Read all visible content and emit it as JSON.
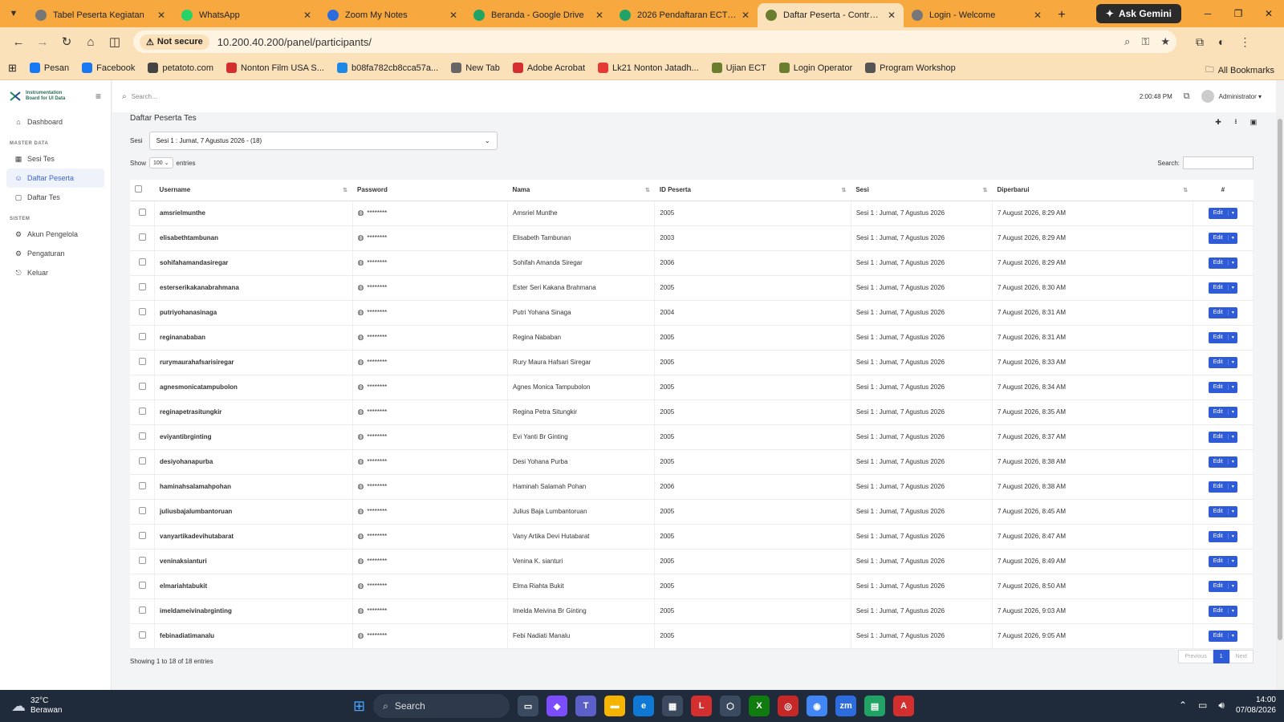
{
  "browser": {
    "tabs": [
      {
        "title": "Tabel Peserta Kegiatan",
        "color": "#777777"
      },
      {
        "title": "WhatsApp",
        "color": "#25d366"
      },
      {
        "title": "Zoom My Notes",
        "color": "#2d6cdf"
      },
      {
        "title": "Beranda - Google Drive",
        "color": "#1fa463"
      },
      {
        "title": "2026 Pendaftaran ECT Offli",
        "color": "#21a366"
      },
      {
        "title": "Daftar Peserta - Control Par",
        "color": "#6b7d2e"
      },
      {
        "title": "Login - Welcome",
        "color": "#777777"
      }
    ],
    "gemini_label": "Ask Gemini",
    "security_label": "Not secure",
    "url": "10.200.40.200/panel/participants/",
    "bookmarks": [
      {
        "label": "Pesan",
        "color": "#1877f2"
      },
      {
        "label": "Facebook",
        "color": "#1877f2"
      },
      {
        "label": "petatoto.com",
        "color": "#444444"
      },
      {
        "label": "Nonton Film USA S...",
        "color": "#d32f2f"
      },
      {
        "label": "b08fa782cb8cca57a...",
        "color": "#1e88e5"
      },
      {
        "label": "New Tab",
        "color": "#666666"
      },
      {
        "label": "Adobe Acrobat",
        "color": "#d32f2f"
      },
      {
        "label": "Lk21 Nonton Jatadh...",
        "color": "#e53935"
      },
      {
        "label": "Ujian ECT",
        "color": "#6b7d2e"
      },
      {
        "label": "Login Operator",
        "color": "#6b7d2e"
      },
      {
        "label": "Program Workshop",
        "color": "#555555"
      }
    ],
    "all_bookmarks_label": "All Bookmarks"
  },
  "sidebar": {
    "brand": "Instrumentation Board for UI Data",
    "items": [
      {
        "label": "Dashboard",
        "icon": "⌂"
      },
      {
        "category": "MASTER DATA"
      },
      {
        "label": "Sesi Tes",
        "icon": "▦"
      },
      {
        "label": "Daftar Peserta",
        "icon": "☺",
        "active": true
      },
      {
        "label": "Daftar Tes",
        "icon": "▢"
      },
      {
        "category": "SISTEM"
      },
      {
        "label": "Akun Pengelola",
        "icon": "⚙"
      },
      {
        "label": "Pengaturan",
        "icon": "⚙"
      },
      {
        "label": "Keluar",
        "icon": "⎋"
      }
    ]
  },
  "topbar": {
    "search_placeholder": "Search...",
    "time": "2:00:48 PM",
    "user": "Administrator ▾"
  },
  "main": {
    "title": "Daftar Peserta Tes",
    "sesi_label": "Sesi",
    "sesi_value": "Sesi 1 : Jumat, 7 Agustus 2026 - (18)",
    "show_label": "Show",
    "show_value": "100",
    "entries_label": "entries",
    "search_label": "Search:",
    "columns": [
      "Username",
      "Password",
      "Nama",
      "ID Peserta",
      "Sesi",
      "Diperbarui",
      "#"
    ],
    "password_mask": "********",
    "edit_label": "Edit",
    "rows": [
      [
        "amsrielmunthe",
        "Amsriel Munthe",
        "2005",
        "Sesi 1 : Jumat, 7 Agustus 2026",
        "7 August 2026, 8:29 AM"
      ],
      [
        "elisabethtambunan",
        "Elisabeth Tambunan",
        "2003",
        "Sesi 1 : Jumat, 7 Agustus 2026",
        "7 August 2026, 8:29 AM"
      ],
      [
        "sohifahamandasiregar",
        "Sohifah Amanda Siregar",
        "2006",
        "Sesi 1 : Jumat, 7 Agustus 2026",
        "7 August 2026, 8:29 AM"
      ],
      [
        "esterserikakanabrahmana",
        "Ester Seri Kakana Brahmana",
        "2005",
        "Sesi 1 : Jumat, 7 Agustus 2026",
        "7 August 2026, 8:30 AM"
      ],
      [
        "putriyohanasinaga",
        "Putri Yohana Sinaga",
        "2004",
        "Sesi 1 : Jumat, 7 Agustus 2026",
        "7 August 2026, 8:31 AM"
      ],
      [
        "reginanababan",
        "Regina Nababan",
        "2005",
        "Sesi 1 : Jumat, 7 Agustus 2026",
        "7 August 2026, 8:31 AM"
      ],
      [
        "rurymaurahafsarisiregar",
        "Rury Maura Hafsari Siregar",
        "2005",
        "Sesi 1 : Jumat, 7 Agustus 2026",
        "7 August 2026, 8:33 AM"
      ],
      [
        "agnesmonicatampubolon",
        "Agnes Monica Tampubolon",
        "2005",
        "Sesi 1 : Jumat, 7 Agustus 2026",
        "7 August 2026, 8:34 AM"
      ],
      [
        "reginapetrasitungkir",
        "Regina Petra Situngkir",
        "2005",
        "Sesi 1 : Jumat, 7 Agustus 2026",
        "7 August 2026, 8:35 AM"
      ],
      [
        "eviyantibrginting",
        "Evi Yanti Br Ginting",
        "2005",
        "Sesi 1 : Jumat, 7 Agustus 2026",
        "7 August 2026, 8:37 AM"
      ],
      [
        "desiyohanapurba",
        "Desi Yohana Purba",
        "2005",
        "Sesi 1 : Jumat, 7 Agustus 2026",
        "7 August 2026, 8:38 AM"
      ],
      [
        "haminahsalamahpohan",
        "Haminah Salamah Pohan",
        "2006",
        "Sesi 1 : Jumat, 7 Agustus 2026",
        "7 August 2026, 8:38 AM"
      ],
      [
        "juliusbajalumbantoruan",
        "Julius Baja Lumbantoruan",
        "2005",
        "Sesi 1 : Jumat, 7 Agustus 2026",
        "7 August 2026, 8:45 AM"
      ],
      [
        "vanyartikadevihutabarat",
        "Vany Artika Devi Hutabarat",
        "2005",
        "Sesi 1 : Jumat, 7 Agustus 2026",
        "7 August 2026, 8:47 AM"
      ],
      [
        "veninaksianturi",
        "Venina K. sianturi",
        "2005",
        "Sesi 1 : Jumat, 7 Agustus 2026",
        "7 August 2026, 8:49 AM"
      ],
      [
        "elmariahtabukit",
        "Elma Riahta Bukit",
        "2005",
        "Sesi 1 : Jumat, 7 Agustus 2026",
        "7 August 2026, 8:50 AM"
      ],
      [
        "imeldameivinabrginting",
        "Imelda Meivina Br Ginting",
        "2005",
        "Sesi 1 : Jumat, 7 Agustus 2026",
        "7 August 2026, 9:03 AM"
      ],
      [
        "febinadiatimanalu",
        "Febi Nadiati Manalu",
        "2005",
        "Sesi 1 : Jumat, 7 Agustus 2026",
        "7 August 2026, 9:05 AM"
      ]
    ],
    "footer_info": "Showing 1 to 18 of 18 entries",
    "pager": {
      "prev": "Previous",
      "current": "1",
      "next": "Next"
    }
  },
  "taskbar": {
    "temp": "32°C",
    "weather": "Berawan",
    "search_label": "Search",
    "time": "14:00",
    "date": "07/08/2026"
  }
}
